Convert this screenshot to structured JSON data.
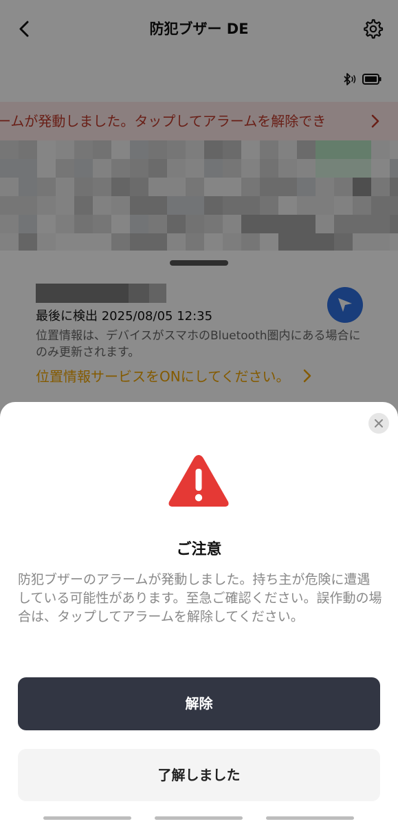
{
  "header": {
    "title": "防犯ブザー DE",
    "icons": [
      "chevron-left-icon",
      "gear-icon",
      "bluetooth-icon",
      "battery-icon"
    ]
  },
  "alarm_banner": {
    "text": "ームが発動しました。タップしてアラームを解除でき",
    "color": "#c0392b",
    "background": "#fde7e7"
  },
  "device": {
    "last_detected": "最後に検出 2025/08/05 12:35",
    "info": "位置情報は、デバイスがスマホのBluetooth圏内にある場合にのみ更新されます。",
    "location_link": "位置情報サービスをONにしてください。"
  },
  "dialog": {
    "title": "ご注意",
    "message": "防犯ブザーのアラームが発動しました。持ち主が危険に遭遇している可能性があります。至急ご確認ください。誤作動の場合は、タップしてアラームを解除してください。",
    "primary_button": "解除",
    "secondary_button": "了解しました"
  },
  "colors": {
    "warning": "#e53935",
    "primary_button": "#323643",
    "link": "#f0a500",
    "nav_button": "#2f6fe0"
  }
}
